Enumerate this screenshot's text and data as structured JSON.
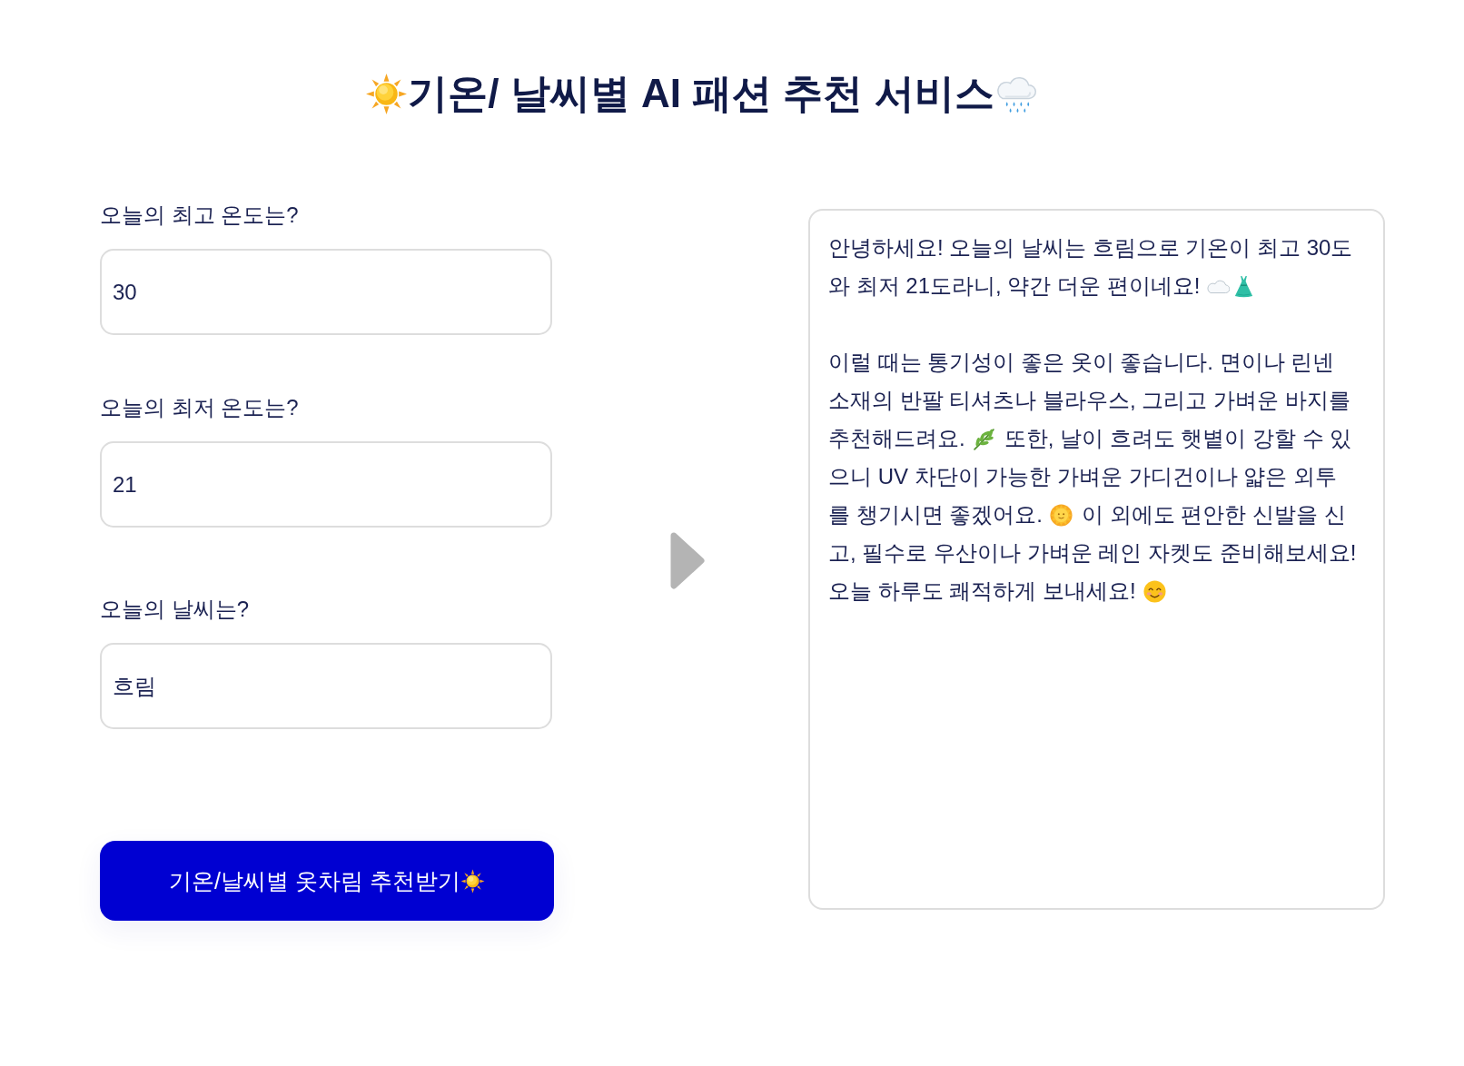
{
  "title": [
    {
      "kind": "icon"
    },
    {
      "kind": "text",
      "text": "기온/ 날씨별 AI 패션 추천 서비스"
    },
    {
      "kind": "icon"
    }
  ],
  "fields": [
    {
      "label": "오늘의 최고 온도는?",
      "value": "30"
    },
    {
      "label": "오늘의 최저 온도는?",
      "value": "21"
    },
    {
      "label": "오늘의 날씨는?",
      "value": "흐림"
    }
  ],
  "submit_button": [
    {
      "kind": "text",
      "text": "기온/날씨별 옷차림 추천받기"
    },
    {
      "kind": "icon"
    }
  ],
  "response": {
    "paragraphs": [
      {
        "lines": [
          [
            {
              "kind": "text",
              "text": "안녕하세요! 오늘의 날씨는 흐림으로 기온이 최고 30도"
            }
          ],
          [
            {
              "kind": "text",
              "text": "와 최저 21도라니, 약간 더운 편이네요!"
            },
            {
              "kind": "icon"
            },
            {
              "kind": "icon"
            }
          ]
        ]
      },
      {
        "lines": [
          [
            {
              "kind": "text",
              "text": "이럴 때는 통기성이 좋은 옷이 좋습니다. 면이나 린넨"
            }
          ],
          [
            {
              "kind": "text",
              "text": "소재의 반팔 티셔츠나 블라우스, 그리고 가벼운 바지를"
            }
          ],
          [
            {
              "kind": "text",
              "text": "추천해드려요."
            },
            {
              "kind": "icon"
            },
            {
              "kind": "text",
              "text": "또한, 날이 흐려도 햇볕이 강할 수 있"
            }
          ],
          [
            {
              "kind": "text",
              "text": "으니 UV 차단이 가능한 가벼운 가디건이나 얇은 외투"
            }
          ],
          [
            {
              "kind": "text",
              "text": "를 챙기시면 좋겠어요."
            },
            {
              "kind": "icon"
            },
            {
              "kind": "text",
              "text": "이 외에도 편안한 신발을 신"
            }
          ],
          [
            {
              "kind": "text",
              "text": "고, 필수로 우산이나 가벼운 레인 자켓도 준비해보세요!"
            }
          ],
          [
            {
              "kind": "text",
              "text": "오늘 하루도 쾌적하게 보내세요!"
            },
            {
              "kind": "icon"
            }
          ]
        ]
      }
    ]
  }
}
